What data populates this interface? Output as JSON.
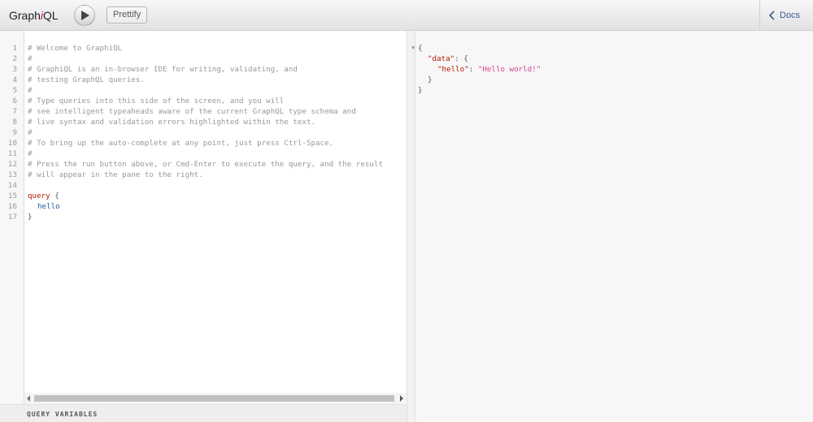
{
  "topbar": {
    "title_prefix": "Graph",
    "title_em": "i",
    "title_suffix": "QL",
    "prettify_label": "Prettify",
    "docs_label": "Docs"
  },
  "editor": {
    "line_numbers": [
      "1",
      "2",
      "3",
      "4",
      "5",
      "6",
      "7",
      "8",
      "9",
      "10",
      "11",
      "12",
      "13",
      "14",
      "15",
      "16",
      "17"
    ],
    "comments": [
      "# Welcome to GraphiQL",
      "#",
      "# GraphiQL is an in-browser IDE for writing, validating, and",
      "# testing GraphQL queries.",
      "#",
      "# Type queries into this side of the screen, and you will",
      "# see intelligent typeaheads aware of the current GraphQL type schema and",
      "# live syntax and validation errors highlighted within the text.",
      "#",
      "# To bring up the auto-complete at any point, just press Ctrl-Space.",
      "#",
      "# Press the run button above, or Cmd-Enter to execute the query, and the result",
      "# will appear in the pane to the right."
    ],
    "query_keyword": "query",
    "open_brace": "{",
    "field": "hello",
    "close_brace": "}"
  },
  "variables": {
    "title": "QUERY VARIABLES"
  },
  "result": {
    "open_brace": "{",
    "data_key": "\"data\"",
    "colon": ": ",
    "data_open": "{",
    "hello_key": "\"hello\"",
    "hello_value": "\"Hello world!\"",
    "inner_close": "}",
    "outer_close": "}",
    "fold_icon": "chevron-down-icon"
  }
}
